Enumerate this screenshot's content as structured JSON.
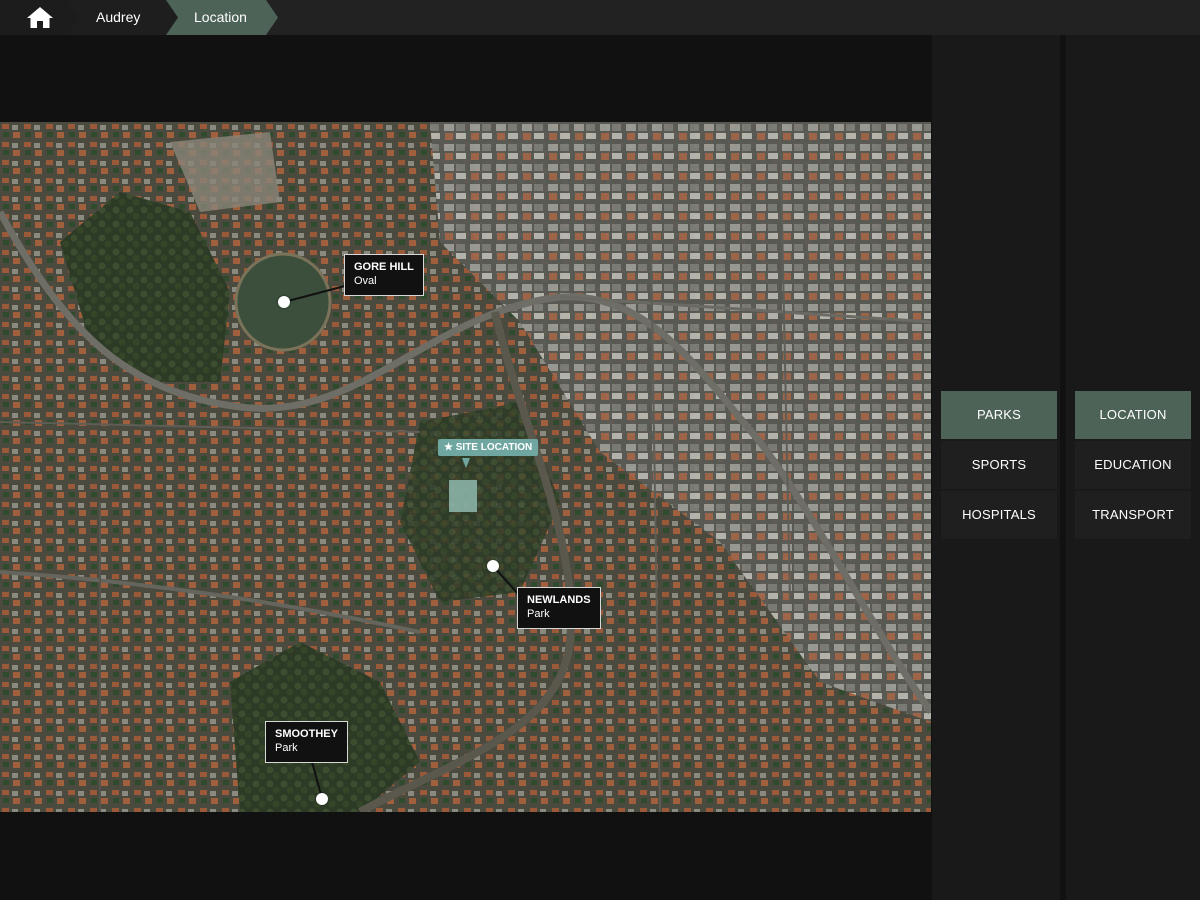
{
  "breadcrumb": {
    "home_icon": "home-icon",
    "items": [
      "Audrey",
      "Location"
    ]
  },
  "map": {
    "markers": {
      "gore_hill": {
        "title": "GORE HILL",
        "subtitle": "Oval"
      },
      "newlands": {
        "title": "NEWLANDS",
        "subtitle": "Park"
      },
      "smoothey": {
        "title": "SMOOTHEY",
        "subtitle": "Park"
      }
    },
    "site_label": "SITE LOCATION",
    "site_icon": "star-icon"
  },
  "menu": {
    "left": [
      "PARKS",
      "SPORTS",
      "HOSPITALS"
    ],
    "right": [
      "LOCATION",
      "EDUCATION",
      "TRANSPORT"
    ],
    "active": [
      "PARKS",
      "LOCATION"
    ]
  },
  "colors": {
    "accent": "#4d6358",
    "background": "#111111",
    "site_label": "#6fa7a0"
  }
}
